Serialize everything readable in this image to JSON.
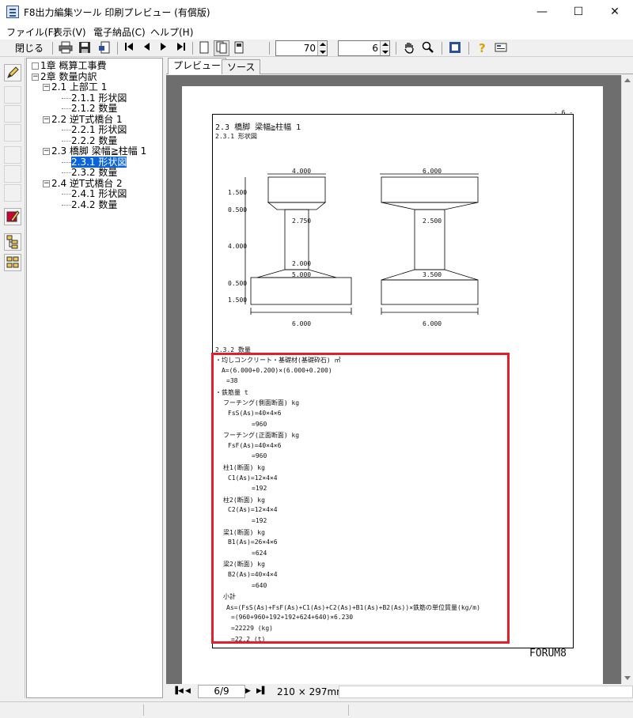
{
  "window": {
    "title": "F8出力編集ツール 印刷プレビュー (有償版)",
    "minimize": "—",
    "maximize": "☐",
    "close": "✕"
  },
  "menu": [
    "ファイル(F)",
    "表示(V)",
    "電子納品(C)",
    "ヘルプ(H)"
  ],
  "toolbar": {
    "close_label": "閉じる(X)",
    "zoom_value": "70",
    "page_value": "6"
  },
  "tabs": [
    "プレビュー",
    "ソース"
  ],
  "tree": [
    {
      "label": "1章 概算工事費",
      "level": 0,
      "expander": ""
    },
    {
      "label": "2章 数量内訳",
      "level": 0,
      "expander": "−"
    },
    {
      "label": "2.1 上部工 1",
      "level": 1,
      "expander": "−"
    },
    {
      "label": "2.1.1 形状図",
      "level": 2,
      "expander": ""
    },
    {
      "label": "2.1.2 数量",
      "level": 2,
      "expander": ""
    },
    {
      "label": "2.2 逆T式橋台 1",
      "level": 1,
      "expander": "−"
    },
    {
      "label": "2.2.1 形状図",
      "level": 2,
      "expander": ""
    },
    {
      "label": "2.2.2 数量",
      "level": 2,
      "expander": ""
    },
    {
      "label": "2.3 橋脚 梁幅≧柱幅 1",
      "level": 1,
      "expander": "−"
    },
    {
      "label": "2.3.1 形状図",
      "level": 2,
      "expander": "",
      "selected": true
    },
    {
      "label": "2.3.2 数量",
      "level": 2,
      "expander": ""
    },
    {
      "label": "2.4 逆T式橋台 2",
      "level": 1,
      "expander": "−"
    },
    {
      "label": "2.4.1 形状図",
      "level": 2,
      "expander": ""
    },
    {
      "label": "2.4.2 数量",
      "level": 2,
      "expander": ""
    }
  ],
  "preview": {
    "page_number": "- 6 -",
    "section_title": "2.3 橋脚 梁幅≧柱幅 1",
    "subsection_shape": "2.3.1 形状図",
    "subsection_qty": "2.3.2 数量",
    "footer_brand": "FORUM8",
    "drawing_left": {
      "top_width": "4.000",
      "col_top": "2.750",
      "col_bottom": "2.000",
      "base_top": "5.000",
      "base_width": "6.000",
      "h1": "1.500",
      "h2": "0.500",
      "h3": "4.000",
      "h4": "0.500",
      "h5": "1.500"
    },
    "drawing_right": {
      "top_width": "6.000",
      "col_top": "2.500",
      "base_top": "3.500",
      "base_width": "6.000"
    },
    "lines": [
      "・均しコンクリート・基礎材(基礎砕石) ㎡",
      "A=(6.000+0.200)×(6.000+0.200)",
      "=38",
      "・鉄筋量 t",
      "フーチング(側面断面) kg",
      "FsS(As)=40×4×6",
      "=960",
      "フーチング(正面断面) kg",
      "FsF(As)=40×4×6",
      "=960",
      "柱1(断面) kg",
      "C1(As)=12×4×4",
      "=192",
      "柱2(断面) kg",
      "C2(As)=12×4×4",
      "=192",
      "梁1(断面) kg",
      "B1(As)=26×4×6",
      "=624",
      "梁2(断面) kg",
      "B2(As)=40×4×4",
      "=640",
      "小計",
      "As=(FsS(As)+FsF(As)+C1(As)+C2(As)+B1(As)+B2(As))×鉄筋の単位質量(kg/m)",
      "=(960+960+192+192+624+640)×6.230",
      "=22229 (kg)",
      "=22.2 (t)"
    ]
  },
  "nav": {
    "page_indicator": "6/9",
    "paper_size": "210 × 297mm"
  }
}
